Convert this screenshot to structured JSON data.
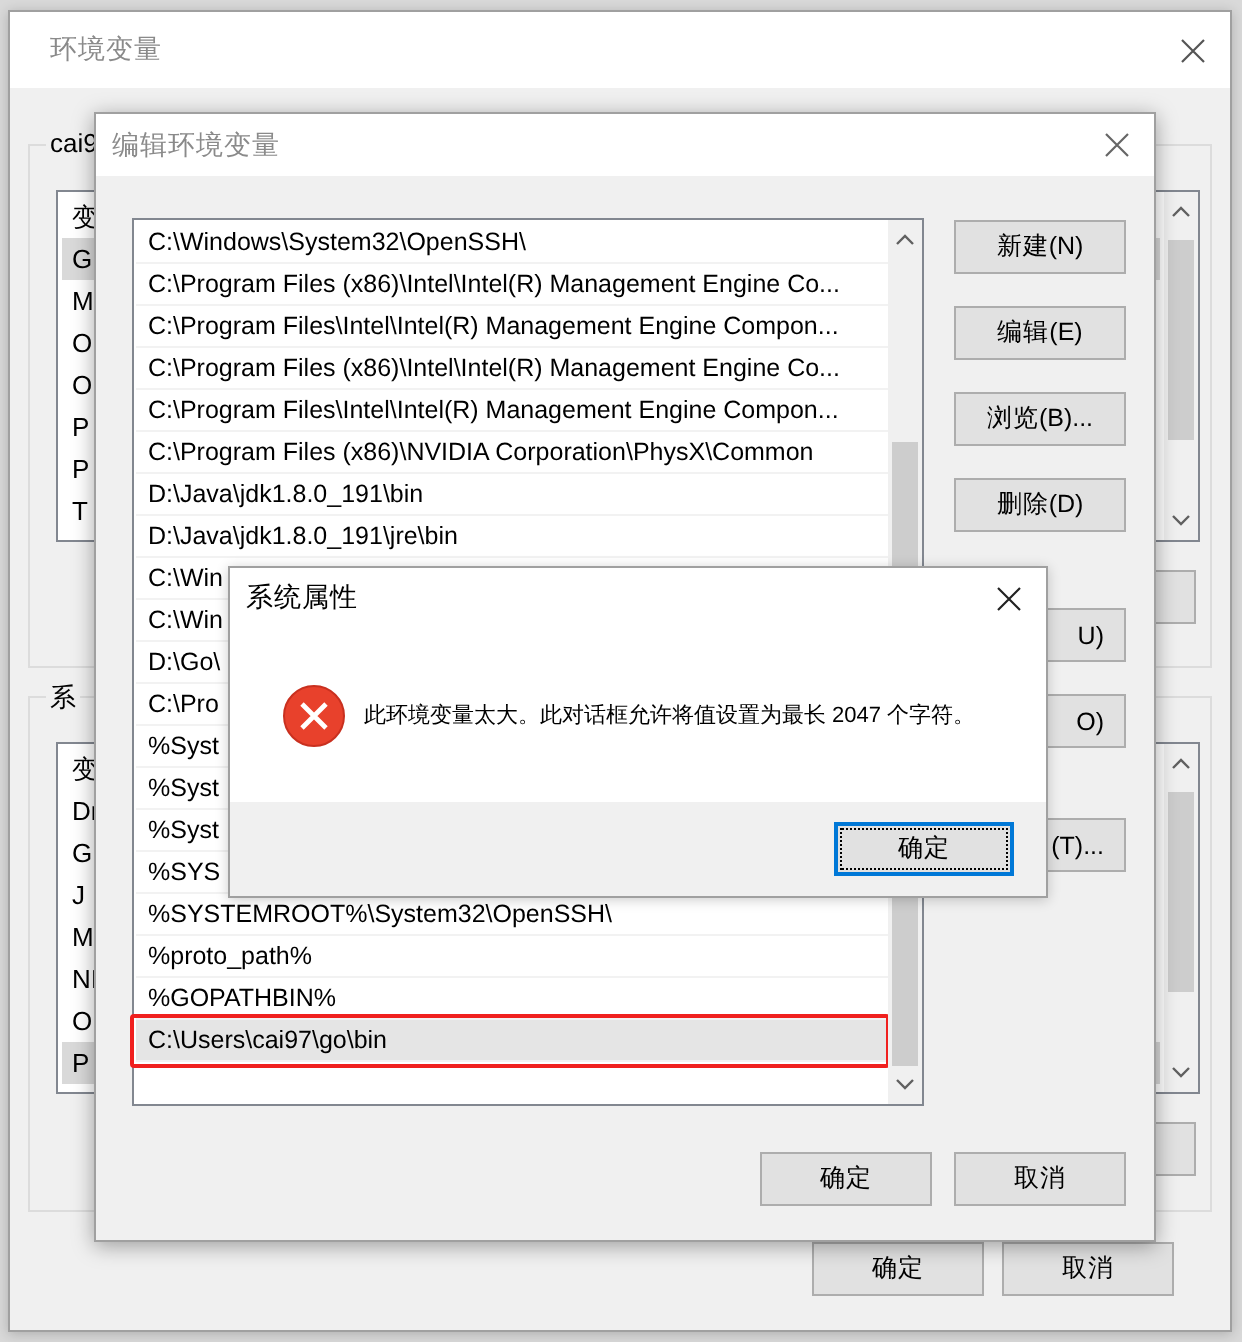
{
  "env_window": {
    "title": "环境变量",
    "user_group": {
      "label": "cai9",
      "header": "变",
      "rows": [
        {
          "text": "G",
          "selected": true
        },
        {
          "text": "M",
          "selected": false
        },
        {
          "text": "O",
          "selected": false
        },
        {
          "text": "O",
          "selected": false
        },
        {
          "text": "P",
          "selected": false
        },
        {
          "text": "P",
          "selected": false
        },
        {
          "text": "T",
          "selected": false
        }
      ]
    },
    "system_group": {
      "label": "系",
      "header": "变",
      "rows": [
        {
          "text": "Dr",
          "selected": false
        },
        {
          "text": "G",
          "selected": false
        },
        {
          "text": "J",
          "selected": false
        },
        {
          "text": "M",
          "selected": false
        },
        {
          "text": "NI",
          "selected": false
        },
        {
          "text": "O",
          "selected": false
        },
        {
          "text": "P",
          "selected": true
        }
      ]
    },
    "buttons": [
      "确定",
      "取消"
    ]
  },
  "edit_dialog": {
    "title": "编辑环境变量",
    "paths": [
      {
        "text": "C:\\Windows\\System32\\OpenSSH\\",
        "selected": false,
        "outlined": false
      },
      {
        "text": "C:\\Program Files (x86)\\Intel\\Intel(R) Management Engine Co...",
        "selected": false,
        "outlined": false
      },
      {
        "text": "C:\\Program Files\\Intel\\Intel(R) Management Engine Compon...",
        "selected": false,
        "outlined": false
      },
      {
        "text": "C:\\Program Files (x86)\\Intel\\Intel(R) Management Engine Co...",
        "selected": false,
        "outlined": false
      },
      {
        "text": "C:\\Program Files\\Intel\\Intel(R) Management Engine Compon...",
        "selected": false,
        "outlined": false
      },
      {
        "text": "C:\\Program Files (x86)\\NVIDIA Corporation\\PhysX\\Common",
        "selected": false,
        "outlined": false
      },
      {
        "text": "D:\\Java\\jdk1.8.0_191\\bin",
        "selected": false,
        "outlined": false
      },
      {
        "text": "D:\\Java\\jdk1.8.0_191\\jre\\bin",
        "selected": false,
        "outlined": false
      },
      {
        "text": "C:\\Win",
        "selected": false,
        "outlined": false
      },
      {
        "text": "C:\\Win",
        "selected": false,
        "outlined": false
      },
      {
        "text": "D:\\Go\\",
        "selected": false,
        "outlined": false
      },
      {
        "text": "C:\\Pro",
        "selected": false,
        "outlined": false
      },
      {
        "text": "%Syst",
        "selected": false,
        "outlined": false
      },
      {
        "text": "%Syst",
        "selected": false,
        "outlined": false
      },
      {
        "text": "%Syst",
        "selected": false,
        "outlined": false
      },
      {
        "text": "%SYS",
        "selected": false,
        "outlined": false
      },
      {
        "text": "%SYSTEMROOT%\\System32\\OpenSSH\\",
        "selected": false,
        "outlined": false
      },
      {
        "text": "%proto_path%",
        "selected": false,
        "outlined": false
      },
      {
        "text": "%GOPATHBIN%",
        "selected": false,
        "outlined": false
      },
      {
        "text": "C:\\Users\\cai97\\go\\bin",
        "selected": true,
        "outlined": true
      }
    ],
    "side_buttons": [
      {
        "label": "新建(N)",
        "kind": "full"
      },
      {
        "label": "编辑(E)",
        "kind": "full"
      },
      {
        "label": "浏览(B)...",
        "kind": "full"
      },
      {
        "label": "删除(D)",
        "kind": "full"
      },
      {
        "label": "U)",
        "kind": "partial"
      },
      {
        "label": "O)",
        "kind": "partial"
      },
      {
        "label": "(T)...",
        "kind": "partial"
      }
    ],
    "buttons": [
      "确定",
      "取消"
    ]
  },
  "message_box": {
    "title": "系统属性",
    "message": "此环境变量太大。此对话框允许将值设置为最长 2047 个字符。",
    "buttons": [
      {
        "label": "确定",
        "focused": true
      }
    ]
  }
}
